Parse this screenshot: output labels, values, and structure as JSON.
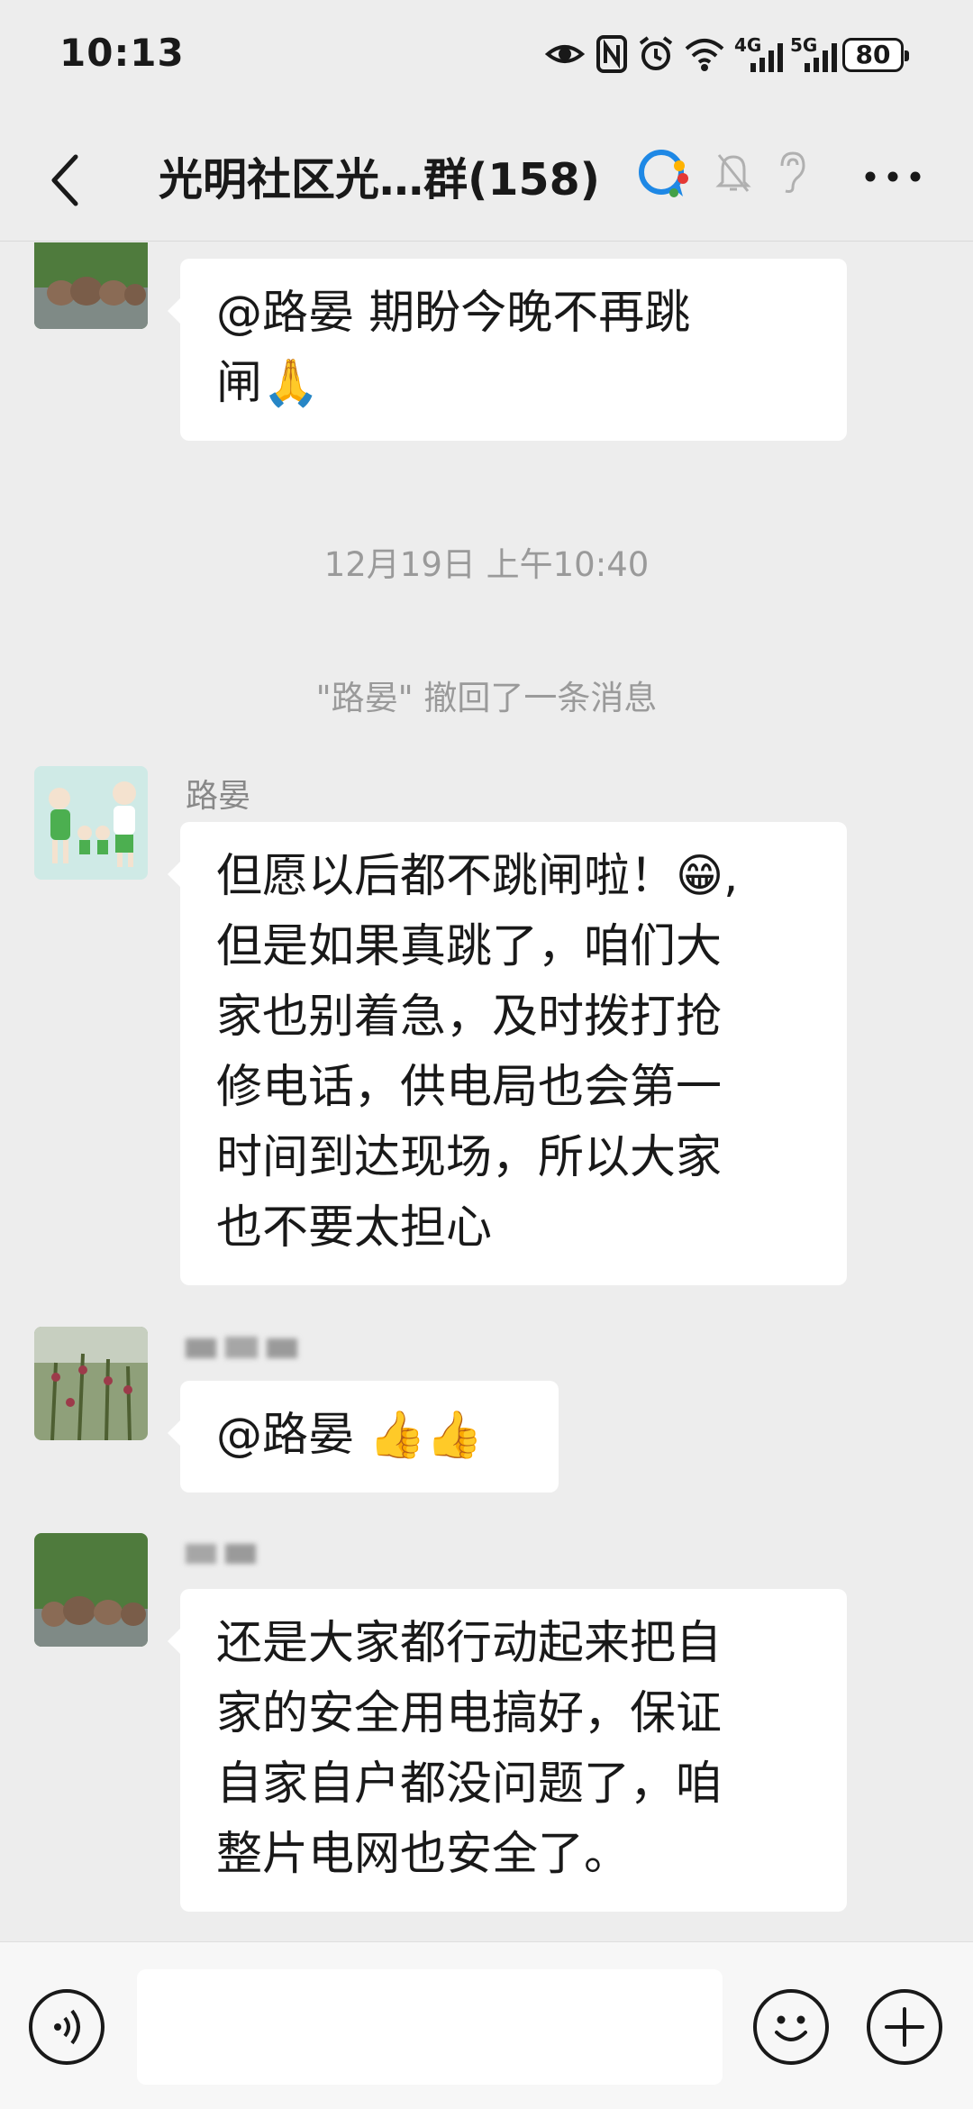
{
  "status_bar": {
    "time": "10:13",
    "net_4g": "4G",
    "net_5g": "5G",
    "battery": "80"
  },
  "header": {
    "title": "光明社区光…群(158)"
  },
  "messages": [
    {
      "lines": [
        "@路晏  期盼今晚不再跳",
        "闸🙏"
      ]
    },
    {
      "sender": "路晏",
      "lines": [
        "但愿以后都不跳闸啦！😁,",
        "但是如果真跳了，咱们大",
        "家也别着急，及时拨打抢",
        "修电话，供电局也会第一",
        "时间到达现场，所以大家",
        "也不要太担心"
      ]
    },
    {
      "lines": [
        "@路晏  👍👍"
      ]
    },
    {
      "lines": [
        "还是大家都行动起来把自",
        "家的安全用电搞好，保证",
        "自家自户都没问题了，咱",
        "整片电网也安全了。"
      ]
    }
  ],
  "timestamp": "12月19日 上午10:40",
  "recall_notice": "\"路晏\" 撤回了一条消息",
  "icons": {
    "back": "back-arrow-icon",
    "more": "more-dots-icon",
    "voice": "voice-icon",
    "emoji": "emoji-icon",
    "plus": "plus-icon"
  },
  "colors": {
    "background": "#ededed",
    "bubble": "#ffffff",
    "meta_text": "#9a9a9a"
  }
}
